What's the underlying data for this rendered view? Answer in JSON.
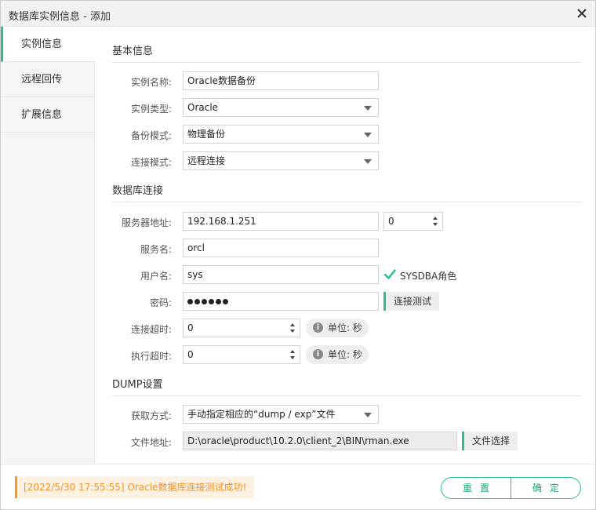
{
  "window": {
    "title": "数据库实例信息 - 添加"
  },
  "sidebar": {
    "items": [
      {
        "label": "实例信息"
      },
      {
        "label": "远程回传"
      },
      {
        "label": "扩展信息"
      }
    ]
  },
  "sections": {
    "basic": "基本信息",
    "connection": "数据库连接",
    "dump": "DUMP设置"
  },
  "basic": {
    "instance_name_label": "实例名称:",
    "instance_name": "Oracle数据备份",
    "instance_type_label": "实例类型:",
    "instance_type": "Oracle",
    "backup_mode_label": "备份模式:",
    "backup_mode": "物理备份",
    "conn_mode_label": "连接模式:",
    "conn_mode": "远程连接"
  },
  "connection": {
    "server_label": "服务器地址:",
    "server": "192.168.1.251",
    "port": "0",
    "service_label": "服务名:",
    "service": "orcl",
    "user_label": "用户名:",
    "user": "sys",
    "sysdba_label": "SYSDBA角色",
    "sysdba_checked": true,
    "password_label": "密码:",
    "password_length": 6,
    "test_button": "连接测试",
    "conn_timeout_label": "连接超时:",
    "conn_timeout": "0",
    "exec_timeout_label": "执行超时:",
    "exec_timeout": "0",
    "unit_label": "单位: 秒"
  },
  "dump": {
    "method_label": "获取方式:",
    "method": "手动指定相应的“dump / exp”文件",
    "path_label": "文件地址:",
    "path": "D:\\oracle\\product\\10.2.0\\client_2\\BIN\\rman.exe",
    "choose_button": "文件选择"
  },
  "footer": {
    "status": "[2022/5/30  17:55:55]  Oracle数据库连接测试成功!",
    "reset_button": "重置",
    "ok_button": "确定"
  },
  "colors": {
    "accent": "#2bbd8b",
    "warning": "#f39c22",
    "warning_bg": "#fdf1e2"
  }
}
